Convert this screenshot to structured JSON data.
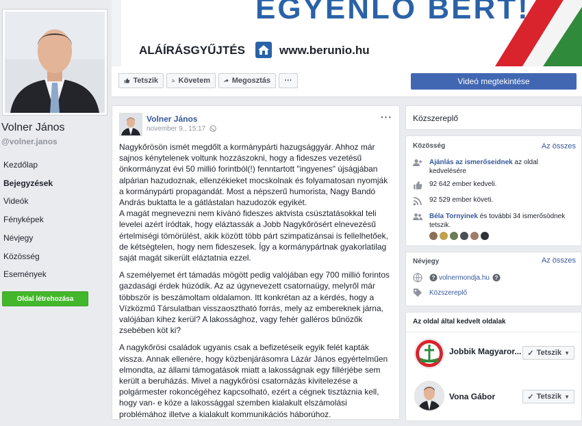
{
  "profile": {
    "name": "Volner János",
    "handle": "@volner.janos"
  },
  "nav": {
    "items": [
      "Kezdőlap",
      "Bejegyzések",
      "Videók",
      "Fényképek",
      "Névjegy",
      "Közösség",
      "Események"
    ],
    "active": "Bejegyzések",
    "create_page": "Oldal létrehozása"
  },
  "cover": {
    "headline": "EGYENLŐ BÉRT!",
    "sign_label": "ALÁÍRÁSGYŰJTÉS",
    "url": "www.berunio.hu"
  },
  "actions": {
    "like": "Tetszik",
    "follow": "Követem",
    "share": "Megosztás",
    "more": "···",
    "video": "Videó megtekintése"
  },
  "post": {
    "author": "Volner János",
    "timestamp": "november 9., 15:17",
    "menu": "···",
    "paragraphs": [
      "Nagykőrösön ismét megdőlt a kormánypárti hazugsággyár. Ahhoz már sajnos kénytelenek voltunk hozzászokni, hogy a fideszes vezetésű önkormányzat évi 50 millió forintból(!) fenntartott \"ingyenes\" újságjában alpárian hazudoznak, ellenzékieket mocskolnak és folyamatosan nyomják a kormánypárti propagandát. Most a népszerű humorista, Nagy Bandó András buktatta le a gátlástalan hazudozók egyikét.\nA magát megnevezni nem kívánó fideszes aktvista csúsztatásokkal teli levelei azért íródtak, hogy eláztassák a Jobb Nagykőrösért elnevezésű értelmiségi tömörülést, akik között több párt szimpatizánsai is fellelhetőek, de kétségtelen, hogy nem fideszesek. Így a kormánypártnak gyakorlatilag saját magát sikerült eláztatnia ezzel.",
      "A személyemet ért támadás mögött pedig valójában egy 700 millió forintos gazdasági érdek húzódik. Az az úgynevezett csatornaügy, melyről már többször is beszámoltam oldalamon. Itt konkrétan az a kérdés, hogy a Vízközmű Társulatban visszaosztható forrás, mely az embereknek járna, valójában kihez kerül? A lakossághoz, vagy fehér galléros bűnözők zsebében köt ki?",
      "A nagykőrösi családok ugyanis csak a befizetéseik egyik felét kapták vissza. Annak ellenére, hogy közbenjárásomra Lázár János egyértelműen elmondta, az állami támogatások miatt a lakosságnak egy fillérjébe sem került a beruházás. Mivel a nagykőrösi csatornázás kivitelezése a polgármester rokoncégéhez kapcsolható, ezért a cégnek tisztáznia kell, hogy van- e köze a lakossággal szemben kialakult elszámolási problémához illetve a kialakult kommunikációs háborúhoz."
    ]
  },
  "sidebar": {
    "category": "Közszereplő",
    "community": {
      "title": "Közösség",
      "see_all": "Az összes",
      "invite_link": "Ajánlás az ismerőseidnek",
      "invite_rest": " az oldal kedvelésére",
      "likes": "92 642 ember kedveli.",
      "follows": "92 529 ember követi.",
      "friends_link": "Béla Tornyinek",
      "friends_rest": " és további 34 ismerősödnek tetszik."
    },
    "about": {
      "title": "Névjegy",
      "see_all": "Az összes",
      "website": "volnermondja.hu",
      "category": "Közszereplő"
    },
    "liked_pages": {
      "title": "Az oldal által kedvelt oldalak",
      "pages": [
        {
          "name": "Jobbik Magyaror...",
          "button": "Tetszik"
        },
        {
          "name": "Vona Gábor",
          "button": "Tetszik"
        }
      ]
    }
  },
  "colors": {
    "brand_blue": "#4267b2",
    "link": "#365899",
    "green": "#42b72a",
    "cover_red": "#d9232d",
    "cover_green": "#2f8a3c"
  }
}
